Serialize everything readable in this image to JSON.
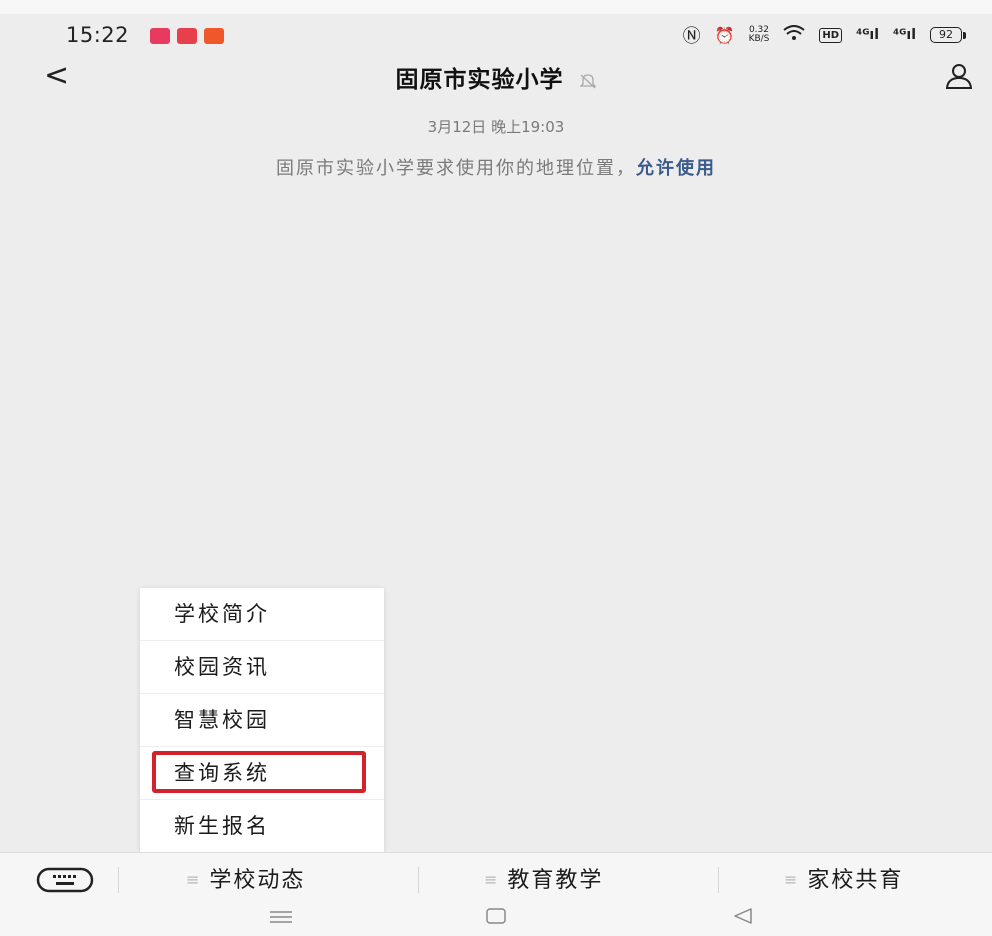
{
  "status_bar": {
    "time": "15:22",
    "speed_value": "0.32",
    "speed_unit": "KB/S",
    "hd_label": "HD",
    "signal_1": "⁴ᴳıl",
    "signal_2": "⁴ᴳıl",
    "battery": "92"
  },
  "header": {
    "back_icon": "<",
    "title": "固原市实验小学",
    "mute_icon": "bell-mute-icon",
    "profile_icon": "person-icon"
  },
  "chat": {
    "timestamp": "3月12日 晚上19:03",
    "location_notice": "固原市实验小学要求使用你的地理位置，",
    "allow_link": "允许使用"
  },
  "submenu": {
    "items": [
      {
        "label": "学校简介"
      },
      {
        "label": "校园资讯"
      },
      {
        "label": "智慧校园"
      },
      {
        "label": "查询系统",
        "highlighted": true
      },
      {
        "label": "新生报名"
      }
    ],
    "highlight_color": "#d2222b"
  },
  "menu_bar": {
    "keyboard_icon": "keyboard-icon",
    "tabs": [
      {
        "label": "学校动态"
      },
      {
        "label": "教育教学"
      },
      {
        "label": "家校共育"
      }
    ]
  },
  "system_nav": {
    "menu_icon": "≡",
    "home_icon": "▢",
    "back_icon": "◁"
  },
  "colors": {
    "background": "#ededed",
    "link": "#3b5b8c",
    "highlight": "#d2222b"
  }
}
